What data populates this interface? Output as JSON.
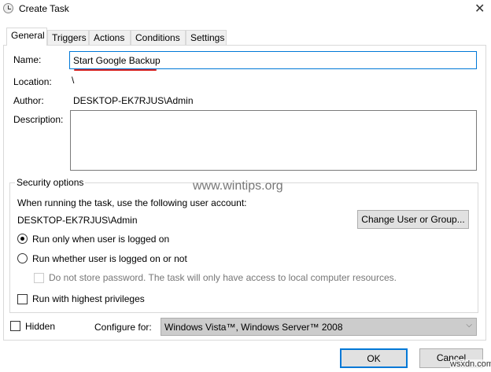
{
  "window": {
    "title": "Create Task",
    "close_icon": "close-icon"
  },
  "tabs": [
    {
      "label": "General",
      "selected": true
    },
    {
      "label": "Triggers"
    },
    {
      "label": "Actions"
    },
    {
      "label": "Conditions"
    },
    {
      "label": "Settings"
    }
  ],
  "general": {
    "name_label": "Name:",
    "name_value": "Start Google Backup",
    "location_label": "Location:",
    "location_value": "\\",
    "author_label": "Author:",
    "author_value": "DESKTOP-EK7RJUS\\Admin",
    "description_label": "Description:",
    "description_value": ""
  },
  "security": {
    "legend": "Security options",
    "account_prompt": "When running the task, use the following user account:",
    "account": "DESKTOP-EK7RJUS\\Admin",
    "change_button": "Change User or Group...",
    "radio_logged_on": "Run only when user is logged on",
    "radio_whether": "Run whether user is logged on or not",
    "no_store_password": "Do not store password.  The task will only have access to local computer resources.",
    "highest_privileges": "Run with highest privileges"
  },
  "hidden_label": "Hidden",
  "configure_label": "Configure for:",
  "configure_value": "Windows Vista™, Windows Server™ 2008",
  "ok": "OK",
  "cancel": "Cancel",
  "watermark": "www.wintips.org",
  "watermark2": "wsxdn.com"
}
